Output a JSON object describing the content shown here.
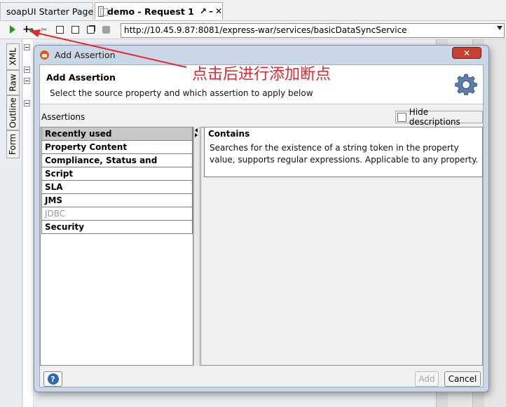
{
  "tabs": [
    {
      "label": "soapUI Starter Page"
    },
    {
      "label": "demo - Request 1"
    }
  ],
  "toolbar": {
    "endpoint_url": "http://10.45.9.87:8081/express-war/services/basicDataSyncService"
  },
  "side_tabs": [
    "XML",
    "Raw",
    "Outline",
    "Form"
  ],
  "dialog": {
    "window_title": "Add Assertion",
    "close_glyph": "✕",
    "header_title": "Add Assertion",
    "header_description": "Select the source property and which assertion to apply below",
    "section_label": "Assertions",
    "hide_descriptions_label": "Hide descriptions",
    "categories": [
      {
        "label": "Recently used",
        "state": "selected"
      },
      {
        "label": "Property Content",
        "state": "normal"
      },
      {
        "label": "Compliance, Status and Standards",
        "state": "normal"
      },
      {
        "label": "Script",
        "state": "normal"
      },
      {
        "label": "SLA",
        "state": "normal"
      },
      {
        "label": "JMS",
        "state": "normal"
      },
      {
        "label": "JDBC",
        "state": "disabled"
      },
      {
        "label": "Security",
        "state": "normal"
      }
    ],
    "assertion": {
      "title": "Contains",
      "description": "Searches for the existence of a string token in the property value, supports regular expressions. Applicable to any property."
    },
    "help_glyph": "?",
    "add_label": "Add",
    "cancel_label": "Cancel"
  },
  "annotation": {
    "text": "点击后进行添加断点",
    "color": "#e8262c"
  },
  "colors": {
    "dialog_frame": "#cad7e6",
    "selected_row": "#c8c8c8",
    "play_green": "#1f9a1f"
  }
}
